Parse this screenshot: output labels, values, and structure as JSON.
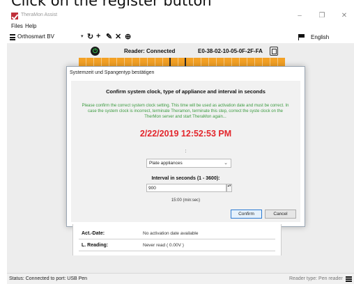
{
  "instruction": "Click on the register button",
  "window": {
    "title": "TheraMon Assist",
    "minimize": "–",
    "maximize": "❐",
    "close": "✕"
  },
  "menu": {
    "items": [
      "Files",
      "Help"
    ]
  },
  "toolbar": {
    "company": "Orthosmart BV",
    "caret": "▾",
    "icons": [
      {
        "name": "refresh-icon",
        "glyph": "↻"
      },
      {
        "name": "add-icon",
        "glyph": "+"
      },
      {
        "name": "edit-icon",
        "glyph": "✎"
      },
      {
        "name": "delete-icon",
        "glyph": "✕"
      },
      {
        "name": "globe-icon",
        "glyph": "⊕"
      }
    ],
    "language": "English"
  },
  "reader": {
    "icon_glyph": "⏻",
    "status": "Reader: Connected",
    "id": "E0-38-02-10-05-0F-2F-FA"
  },
  "dialog": {
    "title": "Systemzeit und Spangentyp bestätigen",
    "heading": "Confirm system clock, type of appliance and interval in seconds",
    "info": "Please confirm the correct system clock setting. This time will be used as activation date and must be correct. In case the system clock is incorrect, terminate Theramon, terminate this step, correct the syste clock on the TherMon server and start TheraMon again...",
    "time": "2/22/2019 12:52:53 PM",
    "colon": ":",
    "appliance": "Plate appliances",
    "appliance_caret": "⌄",
    "interval_label": "Interval in seconds (1 - 3600):",
    "interval_value": "900",
    "spinner": "▴▾",
    "minsec": "15:00 (min:sec)",
    "confirm": "Confirm",
    "cancel": "Cancel"
  },
  "info_panel": {
    "rows": [
      {
        "label": "Act.-Date:",
        "value": "No activation date available"
      },
      {
        "label": "L. Reading:",
        "value": "Never read ( 0.00V )"
      }
    ]
  },
  "status": {
    "text": "Status: Connected to port: USB Pen",
    "reader_type": "Reader type: Pen reader"
  }
}
